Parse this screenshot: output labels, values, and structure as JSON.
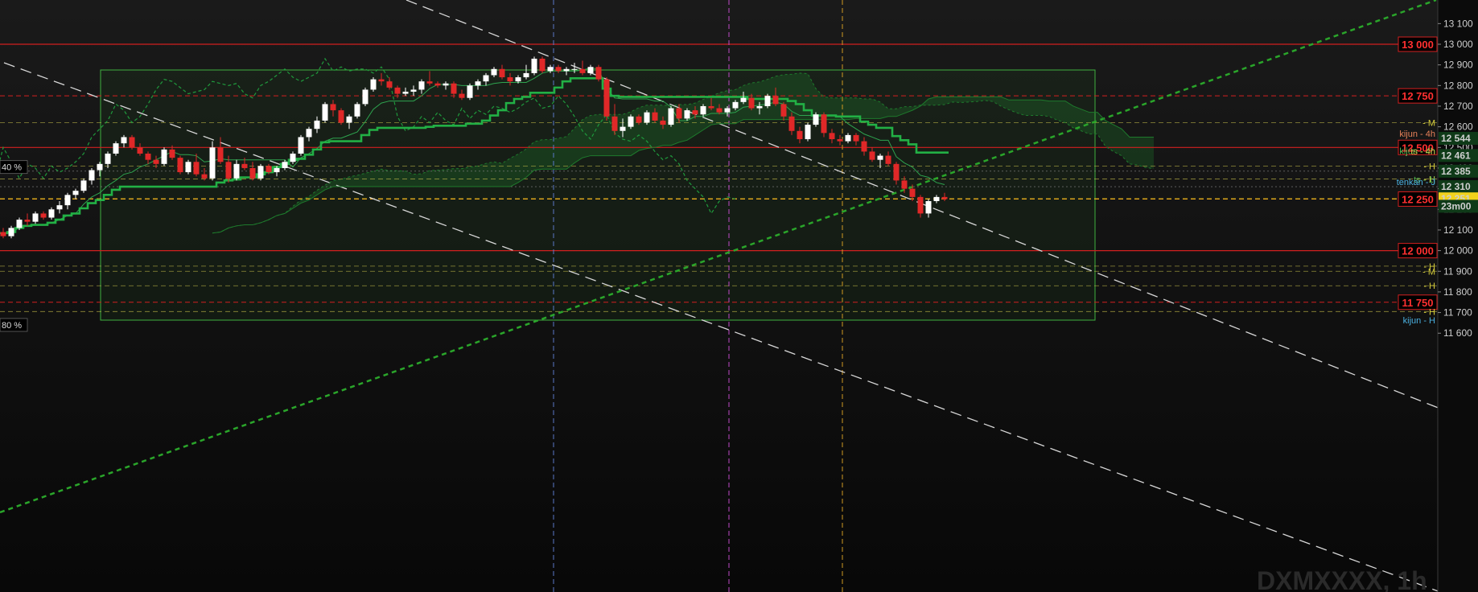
{
  "watermark": "DXMXXXX, 1h",
  "colors": {
    "background": "#0b0b0b",
    "up_candle": "#ffffff",
    "down_candle": "#e02828",
    "kijun": "#22b045",
    "tenkan": "#2ea44f",
    "chikou": "#1f9a3c",
    "cloud": "#1e6b2a",
    "round_level": "#d21f1f",
    "yellow_level": "#c9c14a",
    "current_price": "#f2d21c",
    "trendline": "#d8d8d8",
    "green_trend": "#2aa52a"
  },
  "chart_data": {
    "type": "candlestick",
    "y_axis": {
      "min": 11640,
      "max": 13110,
      "ticks": [
        "13 100",
        "13 000",
        "12 900",
        "12 800",
        "12 700",
        "12 600",
        "12 500",
        "12 400",
        "12 300",
        "12 200",
        "12 100",
        "12 000",
        "11 900",
        "11 800",
        "11 700",
        "11 600"
      ],
      "tick_values": [
        13100,
        13000,
        12900,
        12800,
        12700,
        12600,
        12500,
        12400,
        12300,
        12200,
        12100,
        12000,
        11900,
        11800,
        11700,
        11600
      ]
    },
    "candles": [
      [
        12090,
        12110,
        12060,
        12070
      ],
      [
        12070,
        12120,
        12060,
        12110
      ],
      [
        12110,
        12160,
        12100,
        12150
      ],
      [
        12150,
        12180,
        12120,
        12140
      ],
      [
        12140,
        12190,
        12130,
        12180
      ],
      [
        12180,
        12190,
        12150,
        12160
      ],
      [
        12160,
        12210,
        12150,
        12200
      ],
      [
        12200,
        12240,
        12180,
        12220
      ],
      [
        12220,
        12280,
        12200,
        12270
      ],
      [
        12270,
        12300,
        12250,
        12290
      ],
      [
        12290,
        12350,
        12280,
        12340
      ],
      [
        12340,
        12400,
        12320,
        12390
      ],
      [
        12390,
        12430,
        12360,
        12420
      ],
      [
        12420,
        12480,
        12400,
        12470
      ],
      [
        12470,
        12530,
        12460,
        12520
      ],
      [
        12520,
        12560,
        12500,
        12550
      ],
      [
        12550,
        12560,
        12490,
        12500
      ],
      [
        12500,
        12520,
        12460,
        12470
      ],
      [
        12470,
        12480,
        12420,
        12440
      ],
      [
        12440,
        12460,
        12400,
        12420
      ],
      [
        12420,
        12500,
        12410,
        12490
      ],
      [
        12490,
        12510,
        12440,
        12450
      ],
      [
        12450,
        12460,
        12370,
        12380
      ],
      [
        12380,
        12440,
        12370,
        12430
      ],
      [
        12430,
        12470,
        12360,
        12370
      ],
      [
        12370,
        12400,
        12340,
        12350
      ],
      [
        12350,
        12530,
        12340,
        12500
      ],
      [
        12500,
        12550,
        12420,
        12430
      ],
      [
        12430,
        12460,
        12330,
        12350
      ],
      [
        12350,
        12440,
        12340,
        12420
      ],
      [
        12420,
        12450,
        12390,
        12400
      ],
      [
        12400,
        12430,
        12340,
        12350
      ],
      [
        12350,
        12420,
        12340,
        12410
      ],
      [
        12410,
        12420,
        12370,
        12380
      ],
      [
        12380,
        12410,
        12360,
        12400
      ],
      [
        12400,
        12440,
        12390,
        12430
      ],
      [
        12430,
        12480,
        12420,
        12470
      ],
      [
        12470,
        12560,
        12460,
        12550
      ],
      [
        12550,
        12600,
        12530,
        12590
      ],
      [
        12590,
        12650,
        12570,
        12630
      ],
      [
        12630,
        12720,
        12620,
        12710
      ],
      [
        12710,
        12730,
        12650,
        12680
      ],
      [
        12680,
        12690,
        12610,
        12620
      ],
      [
        12620,
        12660,
        12590,
        12650
      ],
      [
        12650,
        12720,
        12640,
        12710
      ],
      [
        12710,
        12790,
        12700,
        12780
      ],
      [
        12780,
        12840,
        12770,
        12830
      ],
      [
        12830,
        12860,
        12800,
        12820
      ],
      [
        12820,
        12840,
        12780,
        12790
      ],
      [
        12790,
        12800,
        12740,
        12760
      ],
      [
        12760,
        12790,
        12750,
        12770
      ],
      [
        12770,
        12800,
        12750,
        12780
      ],
      [
        12780,
        12830,
        12760,
        12820
      ],
      [
        12820,
        12870,
        12800,
        12810
      ],
      [
        12810,
        12820,
        12790,
        12800
      ],
      [
        12800,
        12820,
        12780,
        12810
      ],
      [
        12810,
        12820,
        12740,
        12760
      ],
      [
        12760,
        12780,
        12730,
        12740
      ],
      [
        12740,
        12810,
        12730,
        12800
      ],
      [
        12800,
        12830,
        12780,
        12820
      ],
      [
        12820,
        12860,
        12800,
        12850
      ],
      [
        12850,
        12890,
        12840,
        12880
      ],
      [
        12880,
        12900,
        12830,
        12840
      ],
      [
        12840,
        12860,
        12800,
        12820
      ],
      [
        12820,
        12850,
        12810,
        12840
      ],
      [
        12840,
        12900,
        12830,
        12860
      ],
      [
        12860,
        12940,
        12850,
        12930
      ],
      [
        12930,
        12940,
        12860,
        12870
      ],
      [
        12870,
        12900,
        12860,
        12890
      ],
      [
        12890,
        12900,
        12860,
        12870
      ],
      [
        12870,
        12890,
        12850,
        12880
      ],
      [
        12880,
        12910,
        12860,
        12880
      ],
      [
        12880,
        12920,
        12850,
        12860
      ],
      [
        12860,
        12900,
        12850,
        12890
      ],
      [
        12890,
        12900,
        12820,
        12830
      ],
      [
        12830,
        12840,
        12630,
        12650
      ],
      [
        12650,
        12710,
        12560,
        12580
      ],
      [
        12580,
        12640,
        12550,
        12600
      ],
      [
        12600,
        12660,
        12590,
        12650
      ],
      [
        12650,
        12660,
        12610,
        12620
      ],
      [
        12620,
        12680,
        12610,
        12670
      ],
      [
        12670,
        12690,
        12620,
        12630
      ],
      [
        12630,
        12650,
        12590,
        12610
      ],
      [
        12610,
        12700,
        12600,
        12690
      ],
      [
        12690,
        12710,
        12620,
        12640
      ],
      [
        12640,
        12690,
        12630,
        12680
      ],
      [
        12680,
        12700,
        12640,
        12660
      ],
      [
        12660,
        12710,
        12650,
        12700
      ],
      [
        12700,
        12740,
        12680,
        12690
      ],
      [
        12690,
        12710,
        12660,
        12670
      ],
      [
        12670,
        12700,
        12650,
        12690
      ],
      [
        12690,
        12730,
        12680,
        12720
      ],
      [
        12720,
        12770,
        12710,
        12740
      ],
      [
        12740,
        12760,
        12680,
        12690
      ],
      [
        12690,
        12720,
        12660,
        12700
      ],
      [
        12700,
        12760,
        12690,
        12750
      ],
      [
        12750,
        12790,
        12700,
        12710
      ],
      [
        12710,
        12720,
        12630,
        12650
      ],
      [
        12650,
        12670,
        12560,
        12580
      ],
      [
        12580,
        12600,
        12520,
        12540
      ],
      [
        12540,
        12620,
        12530,
        12610
      ],
      [
        12610,
        12670,
        12600,
        12660
      ],
      [
        12660,
        12670,
        12550,
        12570
      ],
      [
        12570,
        12590,
        12520,
        12540
      ],
      [
        12540,
        12560,
        12510,
        12530
      ],
      [
        12530,
        12570,
        12520,
        12560
      ],
      [
        12560,
        12570,
        12510,
        12530
      ],
      [
        12530,
        12550,
        12460,
        12480
      ],
      [
        12480,
        12500,
        12430,
        12440
      ],
      [
        12440,
        12470,
        12400,
        12460
      ],
      [
        12460,
        12480,
        12410,
        12420
      ],
      [
        12420,
        12430,
        12320,
        12340
      ],
      [
        12340,
        12360,
        12280,
        12300
      ],
      [
        12300,
        12320,
        12240,
        12260
      ],
      [
        12260,
        12270,
        12160,
        12180
      ],
      [
        12180,
        12250,
        12160,
        12240
      ],
      [
        12240,
        12270,
        12230,
        12260
      ],
      [
        12260,
        12280,
        12240,
        12250
      ]
    ],
    "round_levels": [
      {
        "label": "13 000",
        "value": 13000
      },
      {
        "label": "12 750",
        "value": 12750
      },
      {
        "label": "12 500",
        "value": 12500
      },
      {
        "label": "12 250",
        "value": 12250
      },
      {
        "label": "12 000",
        "value": 12000
      },
      {
        "label": "11 750",
        "value": 11750
      }
    ],
    "level_tags": [
      {
        "label": "- M",
        "value": 12620,
        "color": "#d8cf3c"
      },
      {
        "label": "- H",
        "value": 12410,
        "color": "#d8cf3c"
      },
      {
        "label": "- H",
        "value": 12347,
        "color": "#d8cf3c"
      },
      {
        "label": "- H",
        "value": 11925,
        "color": "#d8cf3c"
      },
      {
        "label": "- M",
        "value": 11900,
        "color": "#d8cf3c"
      },
      {
        "label": "- H",
        "value": 11830,
        "color": "#d8cf3c"
      },
      {
        "label": "- H",
        "value": 11705,
        "color": "#d8cf3c"
      }
    ],
    "indicator_labels": [
      {
        "label": "kijun - 4h",
        "value": 12544,
        "color": "#e8825a"
      },
      {
        "label": "kijun - 4h",
        "value": 12461,
        "color": "#5ac05a"
      },
      {
        "label": "ts - 4h",
        "value": 12458,
        "color": "#c8c04a"
      },
      {
        "label": "ts - 1j",
        "value": 12322,
        "color": "#4fb04f"
      },
      {
        "label": "tenkan - J",
        "value": 12310,
        "color": "#4ab0e0"
      },
      {
        "label": "kijun - H",
        "value": 11640,
        "color": "#4ab0e0"
      }
    ],
    "price_tags": [
      {
        "label": "12 544",
        "value": 12544,
        "bg": "#0f3a18",
        "fg": "#5ad05a"
      },
      {
        "label": "12 461",
        "value": 12461,
        "bg": "#0f3a18",
        "fg": "#5ad05a"
      },
      {
        "label": "12 385",
        "value": 12385,
        "bg": "#0f3a18",
        "fg": "#5ad05a"
      },
      {
        "label": "12 310",
        "value": 12310,
        "bg": "#0f3a18",
        "fg": "#5ad05a"
      },
      {
        "label": "12 251",
        "value": 12251,
        "bg": "#f2d21c",
        "fg": "#111111"
      },
      {
        "label": "23m00",
        "value": 12215,
        "bg": "#0f3a18",
        "fg": "#6de06d"
      }
    ],
    "left_labels": [
      {
        "label": "40 %",
        "value": 12405
      },
      {
        "label": "80 %",
        "value": 11640
      }
    ]
  }
}
